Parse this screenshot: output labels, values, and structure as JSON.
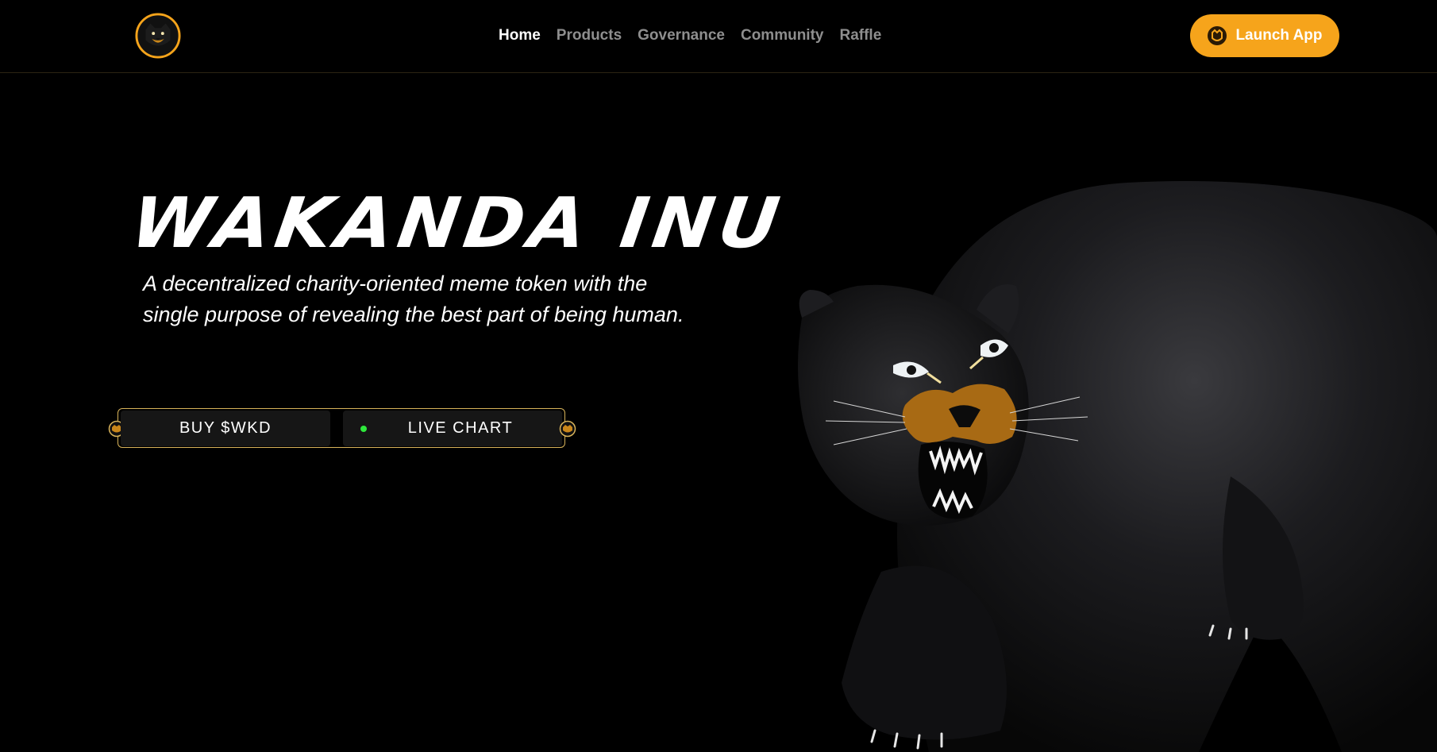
{
  "colors": {
    "background": "#000000",
    "accent": "#f6a41b",
    "nav_inactive": "#8e8e8e",
    "live_indicator": "#2ee83c",
    "button_border": "#d8b35a"
  },
  "header": {
    "logo_icon": "panther-logo-icon",
    "nav": [
      {
        "label": "Home",
        "active": true
      },
      {
        "label": "Products",
        "active": false
      },
      {
        "label": "Governance",
        "active": false
      },
      {
        "label": "Community",
        "active": false
      },
      {
        "label": "Raffle",
        "active": false
      }
    ],
    "launch_button": {
      "label": "Launch App",
      "icon": "app-icon"
    }
  },
  "hero": {
    "title": "WAKANDA INU",
    "description": "A decentralized charity-oriented meme token with the single purpose of revealing the best part of being human.",
    "buttons": {
      "buy": "BUY $WKD",
      "chart": "LIVE CHART"
    },
    "image": "black-panther-illustration"
  }
}
